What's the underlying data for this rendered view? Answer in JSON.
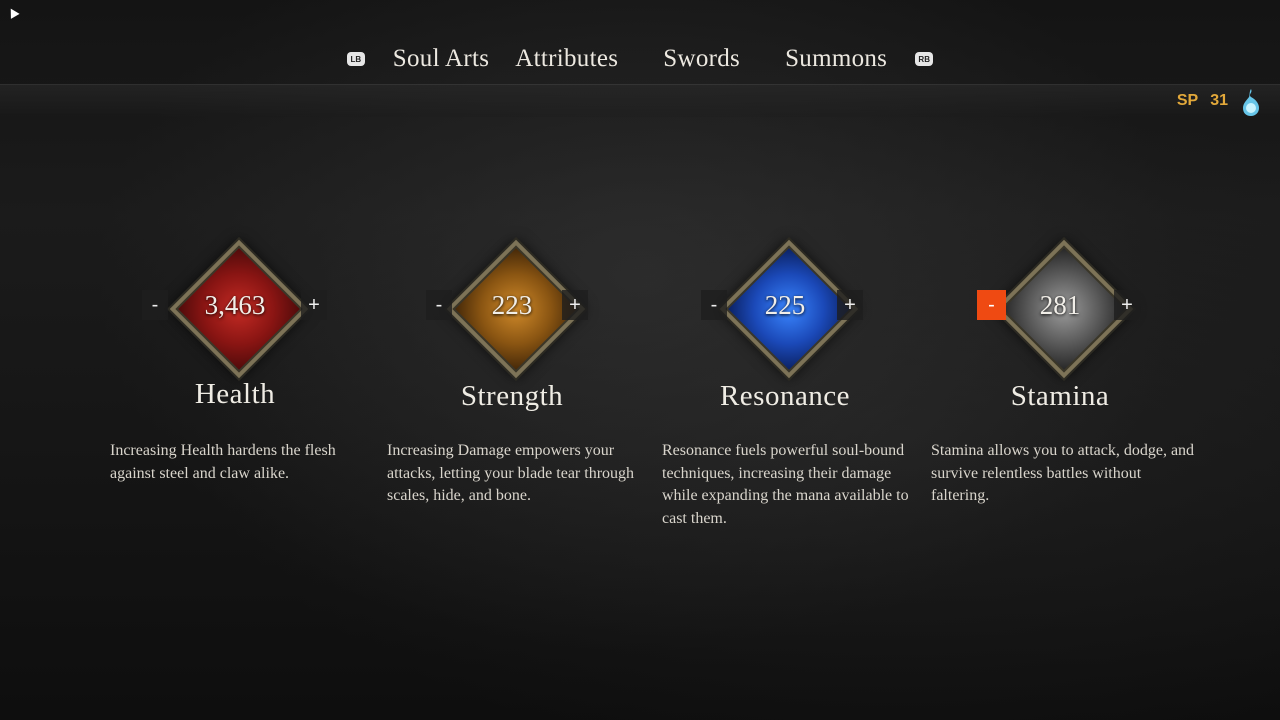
{
  "nav": {
    "left_button": "LB",
    "right_button": "RB",
    "tabs": [
      "Soul Arts",
      "Attributes",
      "Swords",
      "Summons"
    ]
  },
  "sp": {
    "label": "SP",
    "value": "31",
    "icon": "blue-flame-icon"
  },
  "stats": [
    {
      "name": "Health",
      "value": "3,463",
      "minus": "-",
      "plus": "+",
      "color": "#b3201c",
      "desc": "Increasing Health hardens the flesh against steel and claw alike."
    },
    {
      "name": "Strength",
      "value": "223",
      "minus": "-",
      "plus": "+",
      "color": "#c07a1e",
      "desc": "Increasing Damage empowers your attacks, letting your blade tear through scales, hide, and bone."
    },
    {
      "name": "Resonance",
      "value": "225",
      "minus": "-",
      "plus": "+",
      "color": "#1f5fd0",
      "desc": "Resonance fuels powerful soul-bound techniques, increasing their damage while expanding the mana available to cast them."
    },
    {
      "name": "Stamina",
      "value": "281",
      "minus": "-",
      "plus": "+",
      "color": "#8a8a8a",
      "desc": "Stamina allows you to attack, dodge, and survive relentless battles without faltering."
    }
  ],
  "colors": {
    "accent_sp": "#e2a83a",
    "minus_active": "#ef4a12"
  }
}
